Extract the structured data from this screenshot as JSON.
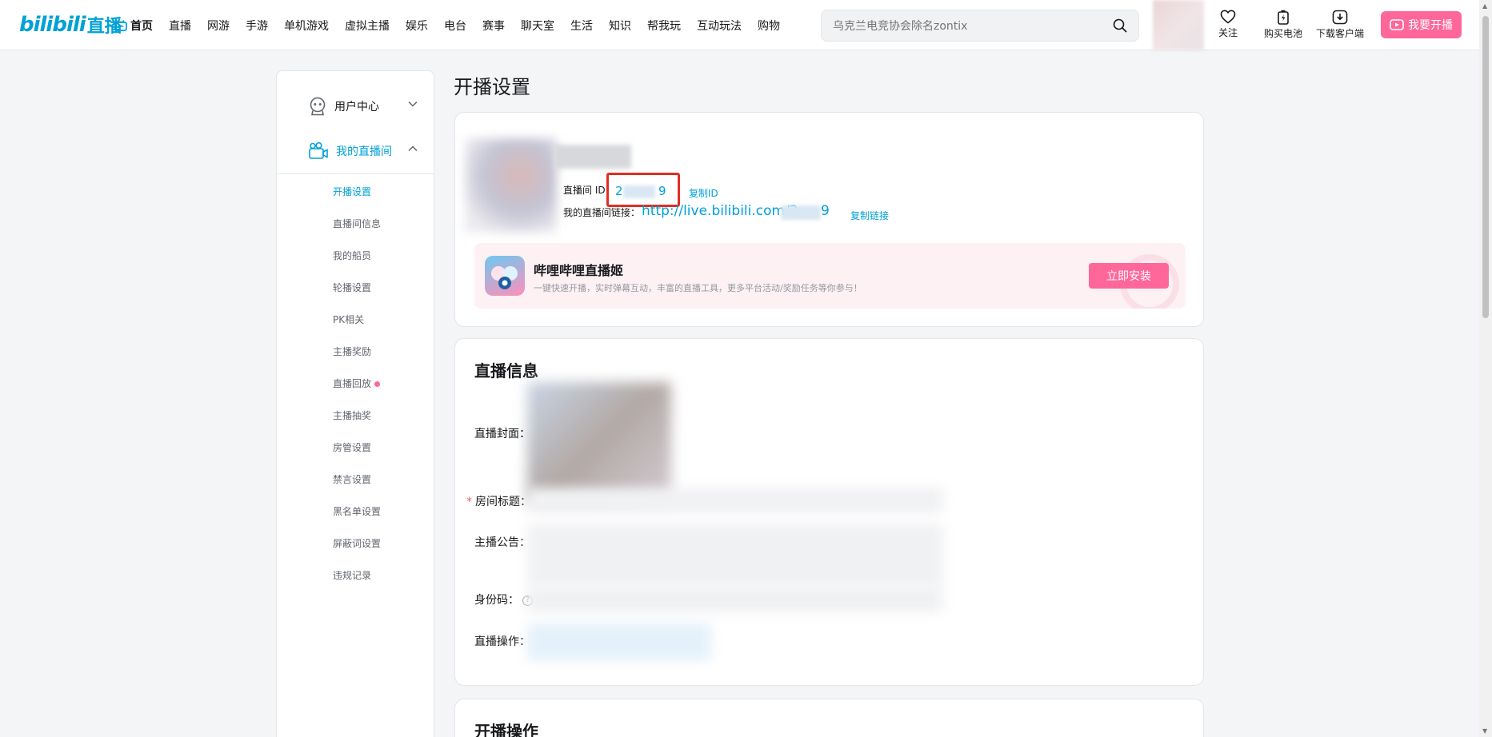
{
  "header": {
    "logo_text": "bilibili",
    "logo_live": "直播",
    "nav": [
      "首页",
      "直播",
      "网游",
      "手游",
      "单机游戏",
      "虚拟主播",
      "娱乐",
      "电台",
      "赛事",
      "聊天室",
      "生活",
      "知识",
      "帮我玩",
      "互动玩法",
      "购物"
    ],
    "search_placeholder": "乌克兰电竞协会除名zontix",
    "follow_label": "关注",
    "battery_label": "购买电池",
    "download_label": "下载客户端",
    "start_live_label": "我要开播"
  },
  "sidebar": {
    "user_center": "用户中心",
    "my_room": "我的直播间",
    "items": [
      "开播设置",
      "直播间信息",
      "我的船员",
      "轮播设置",
      "PK相关",
      "主播奖励",
      "直播回放",
      "主播抽奖",
      "房管设置",
      "禁言设置",
      "黑名单设置",
      "屏蔽词设置",
      "违规记录"
    ]
  },
  "main": {
    "page_title": "开播设置",
    "room_id_label": "直播间 ID：",
    "room_id_first": "2",
    "room_id_last": "9",
    "copy_id": "复制ID",
    "room_link_label": "我的直播间链接：",
    "room_link": "http://live.bilibili.com/2",
    "room_link_end": "9",
    "copy_link": "复制链接",
    "promo": {
      "title": "哔哩哔哩直播姬",
      "desc": "一键快速开播，实时弹幕互动，丰富的直播工具，更多平台活动/奖励任务等你参与！",
      "install": "立即安装"
    },
    "info_section": {
      "title": "直播信息",
      "cover_label": "直播封面：",
      "title_label": "房间标题：",
      "required_mark": "*",
      "notice_label": "主播公告：",
      "id_code_label": "身份码：",
      "help": "?",
      "ops_label": "直播操作："
    },
    "ops_section_title": "开播操作"
  },
  "colors": {
    "brand_blue": "#00a1d6",
    "brand_pink": "#ff6699",
    "highlight_red": "#e02e24"
  }
}
